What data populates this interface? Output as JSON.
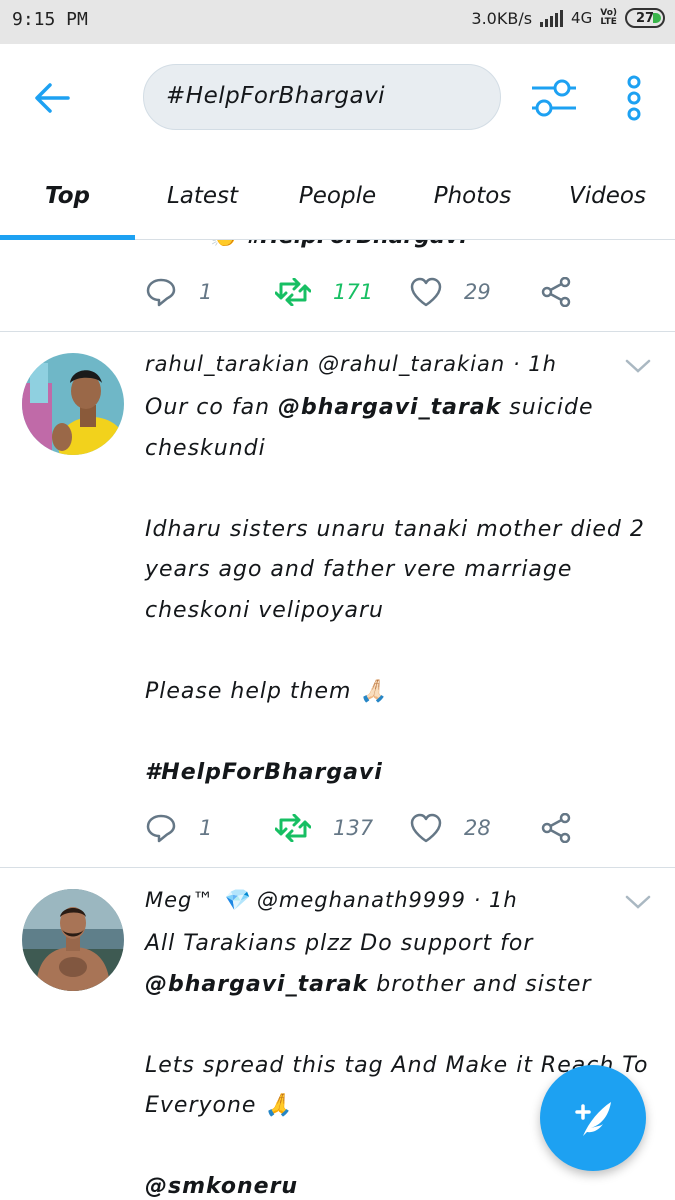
{
  "status_bar": {
    "time": "9:15 PM",
    "speed": "3.0KB/s",
    "network": "4G",
    "volte_top": "Vo)",
    "volte_bottom": "LTE",
    "battery": "27"
  },
  "header": {
    "search_query": "#HelpForBhargavi",
    "back_icon": "arrow-left-icon",
    "filter_icon": "sliders-icon",
    "more_icon": "more-vertical-icon"
  },
  "tabs": [
    {
      "label": "Top",
      "active": true
    },
    {
      "label": "Latest",
      "active": false
    },
    {
      "label": "People",
      "active": false
    },
    {
      "label": "Photos",
      "active": false
    },
    {
      "label": "Videos",
      "active": false
    }
  ],
  "colors": {
    "accent": "#1da1f2",
    "retweet": "#17bf63",
    "muted": "#657786"
  },
  "partial_tweet": {
    "cut_text": "👏 #HelpForBhargavi",
    "replies": "1",
    "retweets": "171",
    "likes": "29"
  },
  "tweets": [
    {
      "name": "rahul_tarakian",
      "handle": "@rahul_tarakian",
      "time": "1h",
      "line1_before": "Our co fan ",
      "line1_mention": "@bhargavi_tarak",
      "line1_after": " suicide cheskundi",
      "para2": "Idharu sisters unaru tanaki mother died 2 years ago and father vere marriage cheskoni velipoyaru",
      "para3": "Please help them 🙏🏻",
      "hashtag": "#HelpForBhargavi",
      "replies": "1",
      "retweets": "137",
      "likes": "28"
    },
    {
      "name": "Meg™ 💎",
      "handle": "@meghanath9999",
      "time": "1h",
      "line1": "All Tarakians plzz Do support for",
      "mention": "@bhargavi_tarak",
      "line2_after": " brother and sister",
      "para2": "Lets spread this tag And Make it Reach To Everyone 🙏",
      "mention2": "@smkoneru"
    }
  ]
}
